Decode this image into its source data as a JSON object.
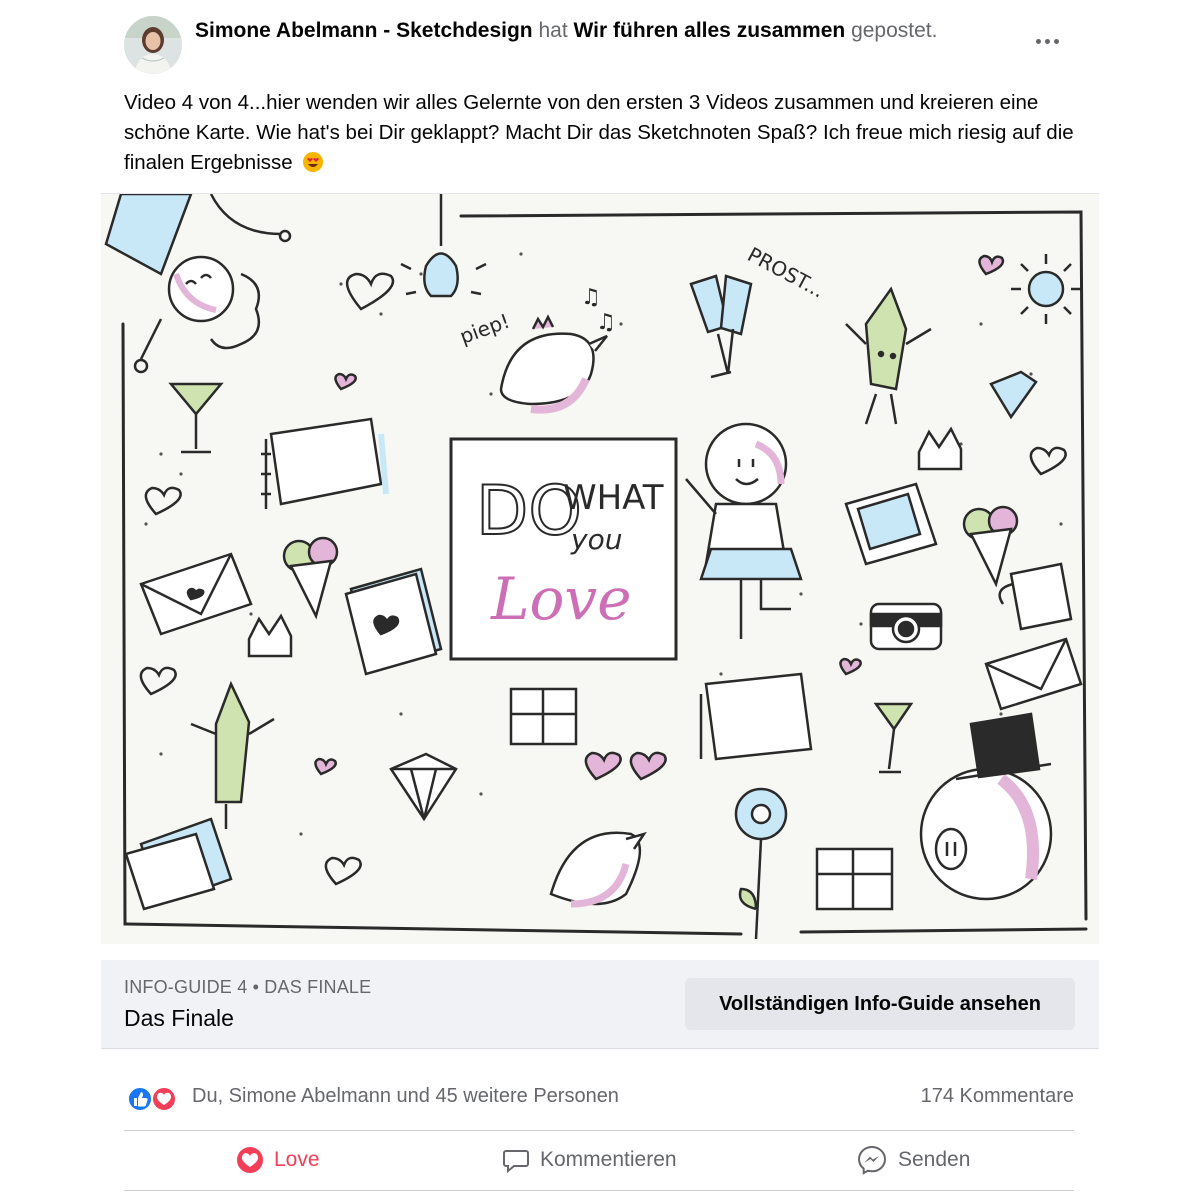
{
  "header": {
    "author": "Simone Abelmann - Sketchdesign",
    "connector": "hat",
    "group": "Wir führen alles zusammen",
    "suffix": "gepostet."
  },
  "post": {
    "text": "Video 4 von 4...hier wenden wir alles Gelernte von den ersten 3 Videos zusammen und kreieren eine schöne Karte. Wie hat's bei Dir geklappt? Macht Dir das Sketchnoten Spaß? Ich freue mich riesig auf die finalen Ergebnisse",
    "emoji": "heart-eyes-emoji"
  },
  "illustration": {
    "sign_line1": "DO",
    "sign_line2": "WHAT",
    "sign_line3": "you",
    "sign_line4": "Love",
    "piep": "piep!",
    "prost": "PROST..."
  },
  "guide": {
    "kicker": "INFO-GUIDE 4 • DAS FINALE",
    "title": "Das Finale",
    "button_label": "Vollständigen Info-Guide ansehen"
  },
  "reactions": {
    "summary": "Du, Simone Abelmann und 45 weitere Personen",
    "comments": "174 Kommentare",
    "icons": [
      "like-icon",
      "love-icon"
    ]
  },
  "actions": {
    "love": "Love",
    "comment": "Kommentieren",
    "send": "Senden"
  },
  "colors": {
    "love": "#f33e58",
    "like": "#1877f2",
    "muted": "#65676b",
    "pink": "#e3b5d8",
    "blue": "#c9e8f7",
    "green": "#cfe3b0"
  }
}
